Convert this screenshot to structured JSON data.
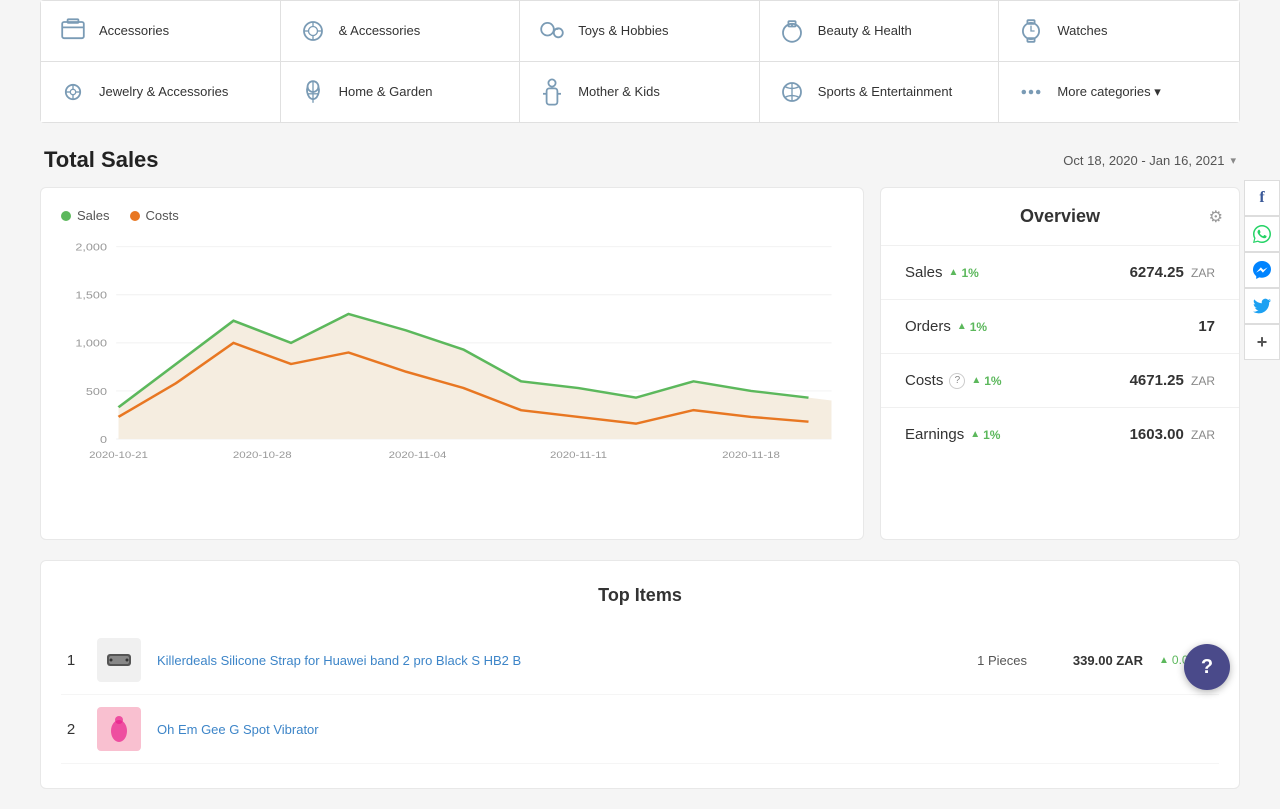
{
  "categories": {
    "top_row": [
      {
        "label": "Accessories",
        "icon": "accessories"
      },
      {
        "label": "& Accessories",
        "icon": "jewelry-accessories"
      },
      {
        "label": "Toys & Hobbies",
        "icon": "toys"
      },
      {
        "label": "Beauty & Health",
        "icon": "beauty"
      },
      {
        "label": "Watches",
        "icon": "watches"
      }
    ],
    "bottom_row": [
      {
        "label": "Jewelry & Accessories",
        "icon": "jewelry"
      },
      {
        "label": "Home & Garden",
        "icon": "home-garden"
      },
      {
        "label": "Mother & Kids",
        "icon": "mother-kids"
      },
      {
        "label": "Sports & Entertainment",
        "icon": "sports"
      },
      {
        "label": "More categories",
        "icon": "more",
        "is_more": true
      }
    ]
  },
  "total_sales": {
    "title": "Total Sales",
    "date_range": "Oct 18, 2020 - Jan 16, 2021"
  },
  "legend": {
    "sales_label": "Sales",
    "costs_label": "Costs"
  },
  "chart": {
    "y_labels": [
      "2,000",
      "1,500",
      "1,000",
      "500",
      "0"
    ],
    "x_labels": [
      "2020-10-21",
      "2020-10-28",
      "2020-11-04",
      "2020-11-11",
      "2020-11-18"
    ]
  },
  "overview": {
    "title": "Overview",
    "rows": [
      {
        "label": "Sales",
        "trend": "1%",
        "value": "6274.25",
        "currency": "ZAR"
      },
      {
        "label": "Orders",
        "trend": "1%",
        "value": "17",
        "currency": ""
      },
      {
        "label": "Costs",
        "trend": "1%",
        "value": "4671.25",
        "currency": "ZAR",
        "has_help": true
      },
      {
        "label": "Earnings",
        "trend": "1%",
        "value": "1603.00",
        "currency": "ZAR"
      }
    ]
  },
  "top_items": {
    "title": "Top Items",
    "items": [
      {
        "rank": "1",
        "name": "Killerdeals Silicone Strap for Huawei band 2 pro Black S HB2 B",
        "qty": "1 Pieces",
        "price": "339.00 ZAR",
        "change": "0.0%",
        "color": "#333"
      },
      {
        "rank": "2",
        "name": "Oh Em Gee G Spot Vibrator",
        "qty": "",
        "price": "",
        "change": "",
        "color": "#e91e8c"
      }
    ]
  },
  "social": {
    "buttons": [
      {
        "icon": "f",
        "label": "facebook",
        "color": "#3b5998"
      },
      {
        "icon": "w",
        "label": "whatsapp",
        "color": "#25d366"
      },
      {
        "icon": "m",
        "label": "messenger",
        "color": "#0084ff"
      },
      {
        "icon": "t",
        "label": "twitter",
        "color": "#1da1f2"
      },
      {
        "icon": "+",
        "label": "share",
        "color": "#555"
      }
    ]
  },
  "help_button": {
    "label": "?"
  }
}
